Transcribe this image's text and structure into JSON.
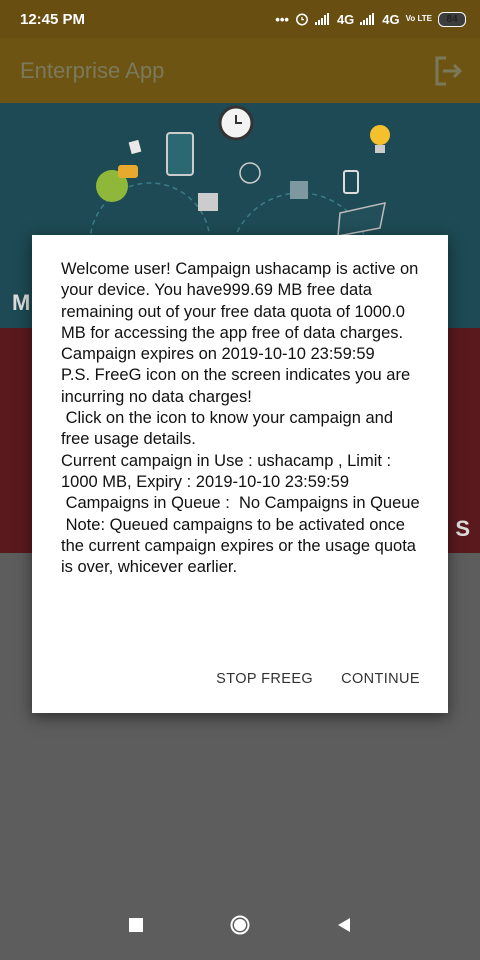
{
  "status_bar": {
    "time": "12:45 PM",
    "network_1": "4G",
    "network_2": "4G",
    "volte": "Vo LTE",
    "battery": "84"
  },
  "app_bar": {
    "title": "Enterprise App"
  },
  "background": {
    "banner_letter": "M",
    "card_letter": "S"
  },
  "dialog": {
    "message": "Welcome user! Campaign ushacamp is active on your device. You have999.69 MB free data remaining out of your free data quota of 1000.0 MB for accessing the app free of data charges. Campaign expires on 2019-10-10 23:59:59\nP.S. FreeG icon on the screen indicates you are incurring no data charges!\n Click on the icon to know your campaign and free usage details.\nCurrent campaign in Use : ushacamp , Limit : 1000 MB, Expiry : 2019-10-10 23:59:59\n Campaigns in Queue :  No Campaigns in Queue\n Note: Queued campaigns to be activated once the current campaign expires or the usage quota is over, whicever earlier.",
    "stop_label": "STOP FREEG",
    "continue_label": "CONTINUE"
  },
  "nav_bar": {
    "recents_icon": "square-icon",
    "home_icon": "circle-icon",
    "back_icon": "triangle-back-icon"
  }
}
